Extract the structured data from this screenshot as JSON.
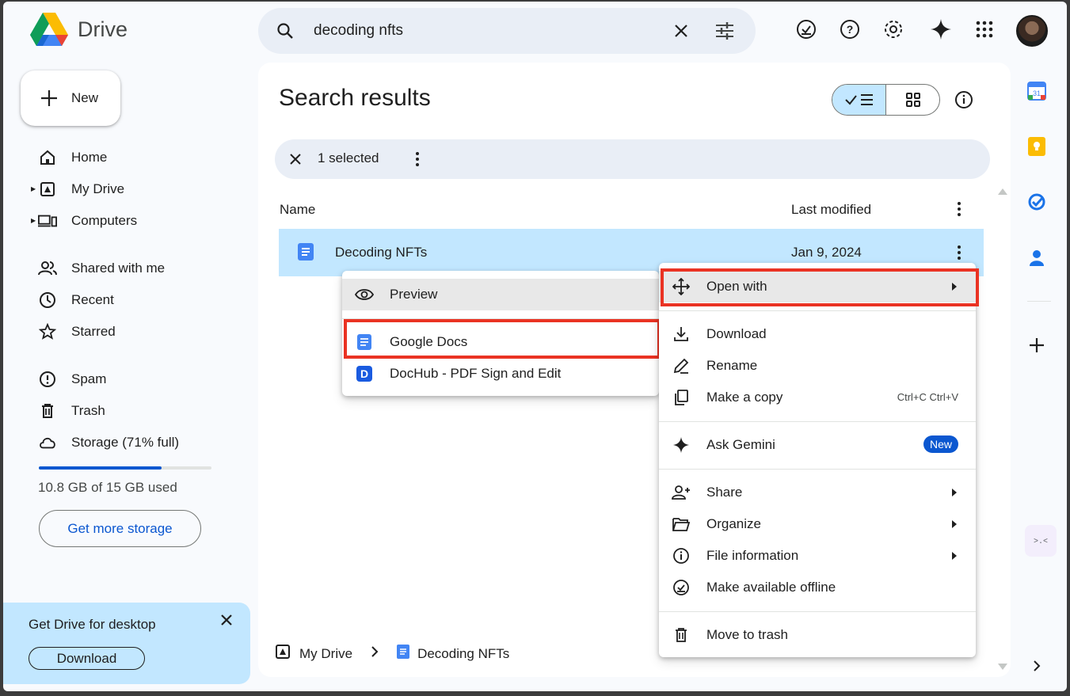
{
  "app": {
    "name": "Drive"
  },
  "search": {
    "value": "decoding nfts"
  },
  "sidebar": {
    "new_label": "New",
    "items": [
      {
        "label": "Home"
      },
      {
        "label": "My Drive"
      },
      {
        "label": "Computers"
      },
      {
        "label": "Shared with me"
      },
      {
        "label": "Recent"
      },
      {
        "label": "Starred"
      },
      {
        "label": "Spam"
      },
      {
        "label": "Trash"
      },
      {
        "label": "Storage (71% full)"
      }
    ],
    "storage_used_fraction": 0.71,
    "storage_text": "10.8 GB of 15 GB used",
    "get_storage_label": "Get more storage"
  },
  "promo": {
    "title": "Get Drive for desktop",
    "download_label": "Download"
  },
  "main": {
    "title": "Search results",
    "selection_text": "1 selected",
    "columns": {
      "name": "Name",
      "modified": "Last modified"
    },
    "files": [
      {
        "name": "Decoding NFTs",
        "modified": "Jan 9, 2024"
      }
    ],
    "breadcrumb": {
      "root": "My Drive",
      "file": "Decoding NFTs"
    }
  },
  "open_with_menu": {
    "items": [
      {
        "label": "Preview"
      },
      {
        "label": "Google Docs"
      },
      {
        "label": "DocHub - PDF Sign and Edit"
      }
    ]
  },
  "context_menu": {
    "open_with": "Open with",
    "download": "Download",
    "rename": "Rename",
    "make_copy": "Make a copy",
    "copy_shortcut": "Ctrl+C Ctrl+V",
    "ask_gemini": "Ask Gemini",
    "new_badge": "New",
    "share": "Share",
    "organize": "Organize",
    "file_info": "File information",
    "offline": "Make available offline",
    "trash": "Move to trash"
  },
  "colors": {
    "accent": "#0b57d0",
    "selection": "#c2e7ff",
    "highlight": "#ea3323"
  }
}
